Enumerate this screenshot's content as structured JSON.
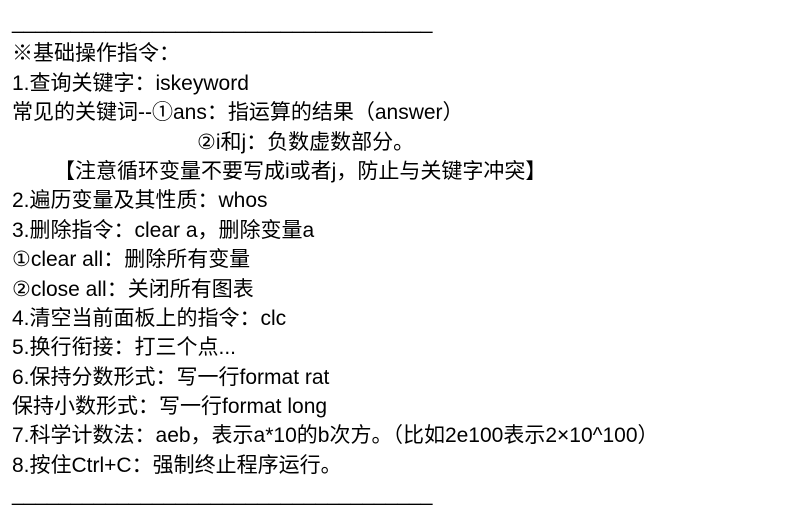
{
  "divider_top": "____________________________________",
  "title": "※基础操作指令：",
  "line1": "1.查询关键字：iskeyword",
  "line2": "常见的关键词--①ans：指运算的结果（answer）",
  "line3": "②i和j：负数虚数部分。",
  "line4": "【注意循环变量不要写成i或者j，防止与关键字冲突】",
  "line5": "2.遍历变量及其性质：whos",
  "line6": "3.删除指令：clear a，删除变量a",
  "line7": "①clear all：删除所有变量",
  "line8": "②close all：关闭所有图表",
  "line9": "4.清空当前面板上的指令：clc",
  "line10": "5.换行衔接：打三个点...",
  "line11": "6.保持分数形式：写一行format rat",
  "line12": "保持小数形式：写一行format long",
  "line13": "7.科学计数法：aeb，表示a*10的b次方。（比如2e100表示2×10^100）",
  "line14": "8.按住Ctrl+C：强制终止程序运行。",
  "divider_bottom": "____________________________________"
}
